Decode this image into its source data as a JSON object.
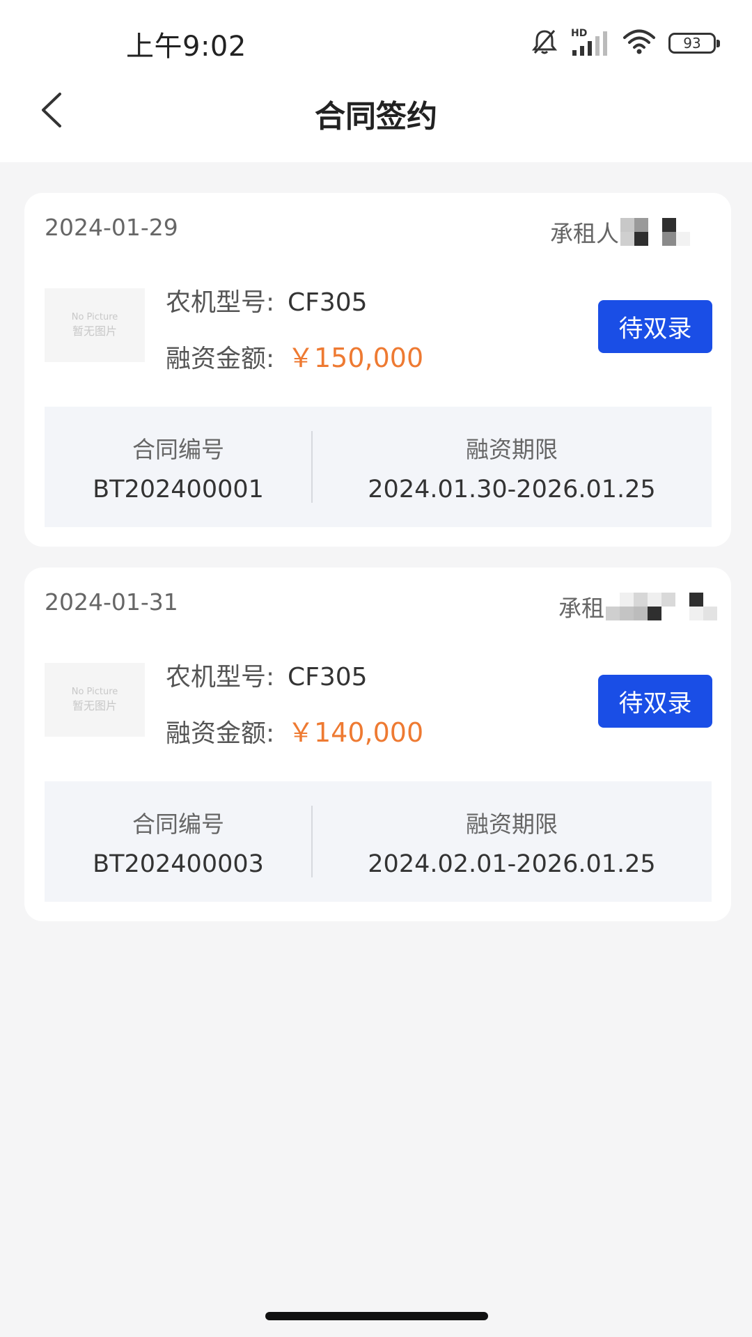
{
  "status_bar": {
    "time": "上午9:02",
    "network_badge": "HD",
    "battery_level": "93",
    "icons": [
      "mute-bell-icon",
      "cellular-signal-icon",
      "wifi-icon",
      "battery-icon"
    ]
  },
  "header": {
    "title": "合同签约",
    "back_icon": "chevron-left-icon"
  },
  "contracts": [
    {
      "date": "2024-01-29",
      "lessee_label": "承租人",
      "thumbnail": {
        "line1": "No Picture",
        "line2": "暂无图片"
      },
      "model_label": "农机型号:",
      "model_value": "CF305",
      "amount_label": "融资金额:",
      "amount_value": "￥150,000",
      "status_button": "待双录",
      "contract_no_label": "合同编号",
      "contract_no": "BT202400001",
      "term_label": "融资期限",
      "term": "2024.01.30-2026.01.25"
    },
    {
      "date": "2024-01-31",
      "lessee_label": "承租",
      "thumbnail": {
        "line1": "No Picture",
        "line2": "暂无图片"
      },
      "model_label": "农机型号:",
      "model_value": "CF305",
      "amount_label": "融资金额:",
      "amount_value": "￥140,000",
      "status_button": "待双录",
      "contract_no_label": "合同编号",
      "contract_no": "BT202400003",
      "term_label": "融资期限",
      "term": "2024.02.01-2026.01.25"
    }
  ],
  "colors": {
    "primary_button": "#1a4ee6",
    "amount": "#ee7a32",
    "background": "#f5f5f6",
    "info_box": "#f3f5f9"
  }
}
